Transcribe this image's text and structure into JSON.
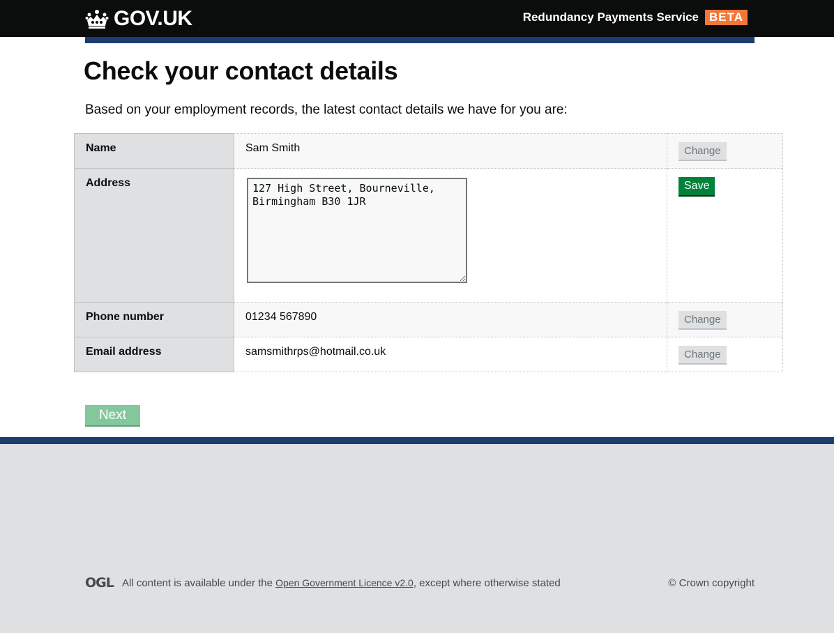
{
  "header": {
    "logo_text": "GOV.UK",
    "service_name": "Redundancy Payments Service",
    "phase_tag": "BETA"
  },
  "page": {
    "title": "Check your contact details",
    "intro": "Based on your employment records, the latest contact details we have for you are:"
  },
  "details": {
    "name": {
      "label": "Name",
      "value": "Sam Smith",
      "action": "Change"
    },
    "address": {
      "label": "Address",
      "value": "127 High Street, Bourneville, Birmingham B30 1JR",
      "action": "Save"
    },
    "phone": {
      "label": "Phone number",
      "value": "01234 567890",
      "action": "Change"
    },
    "email": {
      "label": "Email address",
      "value": "samsmithrps@hotmail.co.uk",
      "action": "Change"
    }
  },
  "actions": {
    "next_label": "Next"
  },
  "footer": {
    "ogl_logo": "OGL",
    "licence_prefix": "All content is available under the ",
    "licence_link": "Open Government Licence v2.0",
    "licence_suffix": ", except where otherwise stated",
    "copyright": "© Crown copyright"
  },
  "colors": {
    "header_bg": "#0b0c0c",
    "brand_blue": "#1d3d6e",
    "beta_tag": "#f47738",
    "save_button": "#00823b",
    "next_button_disabled": "#85c79d",
    "footer_bg": "#dee0e2"
  }
}
